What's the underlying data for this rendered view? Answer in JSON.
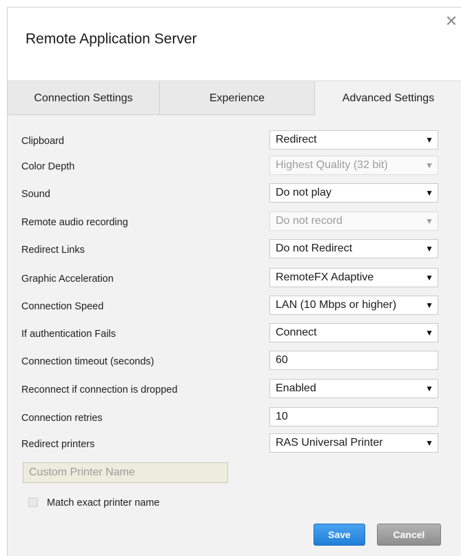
{
  "dialog": {
    "title": "Remote Application Server",
    "close_glyph": "✕"
  },
  "tabs": [
    {
      "label": "Connection Settings",
      "active": false
    },
    {
      "label": "Experience",
      "active": false
    },
    {
      "label": "Advanced Settings",
      "active": true
    }
  ],
  "settings": [
    {
      "label": "Clipboard",
      "value": "Redirect",
      "type": "select",
      "disabled": false
    },
    {
      "label": "Color Depth",
      "value": "Highest Quality (32 bit)",
      "type": "select",
      "disabled": true
    },
    {
      "label": "Sound",
      "value": "Do not play",
      "type": "select",
      "disabled": false
    },
    {
      "label": "Remote audio recording",
      "value": "Do not record",
      "type": "select",
      "disabled": true
    },
    {
      "label": "Redirect Links",
      "value": "Do not Redirect",
      "type": "select",
      "disabled": false
    },
    {
      "label": "Graphic Acceleration",
      "value": "RemoteFX Adaptive",
      "type": "select",
      "disabled": false
    },
    {
      "label": "Connection Speed",
      "value": "LAN (10 Mbps or higher)",
      "type": "select",
      "disabled": false
    },
    {
      "label": "If authentication Fails",
      "value": "Connect",
      "type": "select",
      "disabled": false
    },
    {
      "label": "Connection timeout (seconds)",
      "value": "60",
      "type": "input",
      "disabled": false
    },
    {
      "label": "Reconnect if connection is dropped",
      "value": "Enabled",
      "type": "select",
      "disabled": false
    },
    {
      "label": "Connection retries",
      "value": "10",
      "type": "input",
      "disabled": false
    },
    {
      "label": "Redirect printers",
      "value": "RAS Universal Printer",
      "type": "select",
      "disabled": false
    }
  ],
  "custom_printer": {
    "placeholder": "Custom Printer Name",
    "disabled": true
  },
  "match_exact": {
    "label": "Match exact printer name",
    "checked": false,
    "disabled": true
  },
  "buttons": {
    "save_label": "Save",
    "cancel_label": "Cancel"
  },
  "dropdown_arrow_glyph": "▼",
  "colors": {
    "save_blue": "#1f7fd8",
    "cancel_gray": "#8e8e8e",
    "panel_bg": "#f2f2f2"
  }
}
